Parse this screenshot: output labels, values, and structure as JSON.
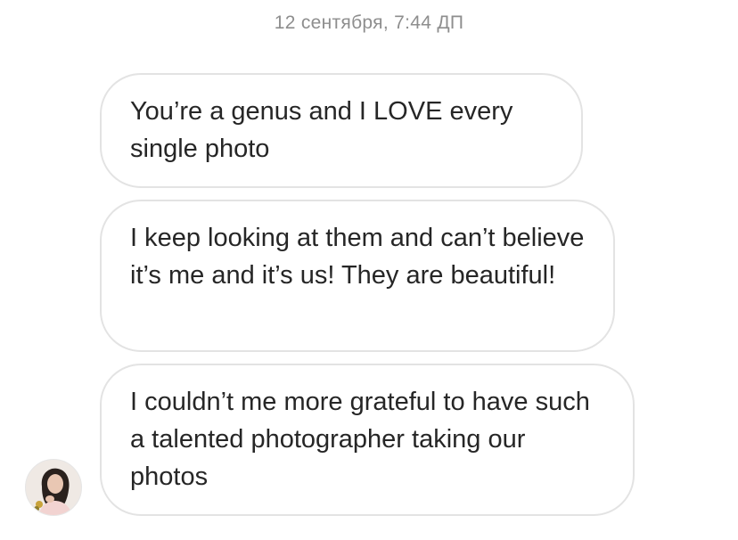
{
  "thread": {
    "timestamp": "12 сентября, 7:44 ДП",
    "messages": [
      {
        "text": "You’re a genus and I LOVE every single photo"
      },
      {
        "text": "I keep looking at them and can’t believe it’s me and it’s us! They are beautiful!"
      },
      {
        "text": "I couldn’t me more grateful to have such a talented photographer taking our photos"
      }
    ]
  },
  "sender": {
    "avatar_icon": "user-avatar-photo"
  },
  "colors": {
    "bubble_border": "#e3e3e3",
    "text": "#262626",
    "timestamp": "#8e8e8e"
  }
}
